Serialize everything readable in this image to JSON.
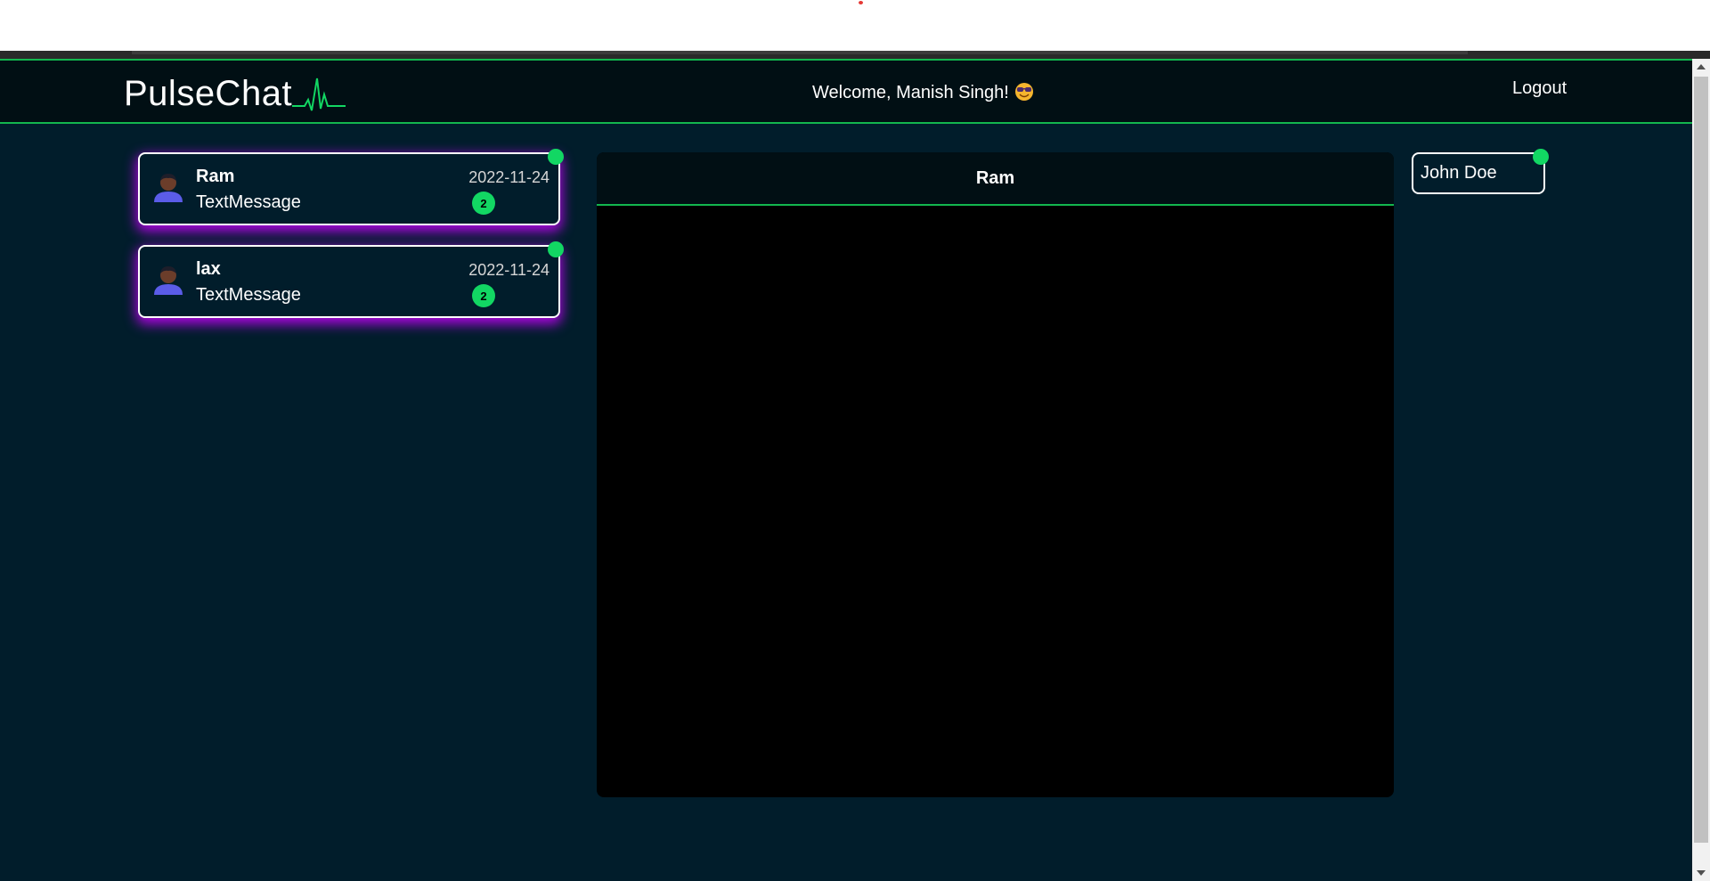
{
  "navbar": {
    "brand": "PulseChat",
    "welcome": "Welcome, Manish Singh!",
    "welcome_emoji": "sunglasses-emoji-icon",
    "logout": "Logout"
  },
  "conversations": [
    {
      "name": "Ram",
      "last_message": "TextMessage",
      "date": "2022-11-24",
      "unread": "2",
      "online": true
    },
    {
      "name": "lax",
      "last_message": "TextMessage",
      "date": "2022-11-24",
      "unread": "2",
      "online": true
    }
  ],
  "chat": {
    "title": "Ram",
    "messages": []
  },
  "online_users": [
    {
      "name": "John Doe",
      "online": true
    }
  ],
  "colors": {
    "background": "#011d2b",
    "navbar": "#010f14",
    "accent_green": "#12b64e",
    "online": "#12d763",
    "glow": "#c800ff"
  }
}
